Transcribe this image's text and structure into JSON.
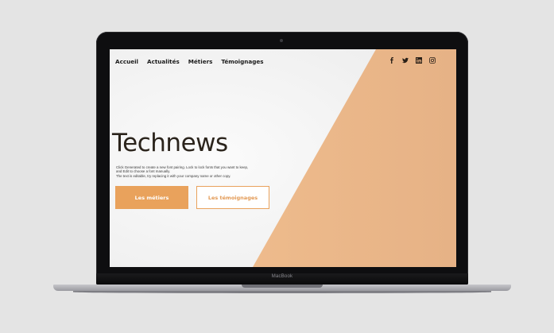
{
  "device": {
    "brand_label": "MacBook"
  },
  "nav": {
    "items": [
      {
        "label": "Accueil",
        "active": true
      },
      {
        "label": "Actualités",
        "active": false
      },
      {
        "label": "Métiers",
        "active": false
      },
      {
        "label": "Témoignages",
        "active": false
      }
    ]
  },
  "social": {
    "icons": [
      "facebook-icon",
      "twitter-icon",
      "linkedin-icon",
      "instagram-icon"
    ]
  },
  "hero": {
    "title": "Technews",
    "text_lines": [
      "Click Generated to create a new font pairing. Lock to lock fonts that you want to keep,",
      "and Edit to choose a font manually.",
      "The text is editable, try replacing it with your company name or other copy."
    ],
    "primary_button": "Les métiers",
    "secondary_button": "Les témoignages"
  },
  "colors": {
    "accent": "#e9a25c",
    "diagonal_panel": "#edb889",
    "screen_background": "#f6f6f6",
    "bezel": "#0e0e10",
    "page_background": "#e4e4e4"
  }
}
